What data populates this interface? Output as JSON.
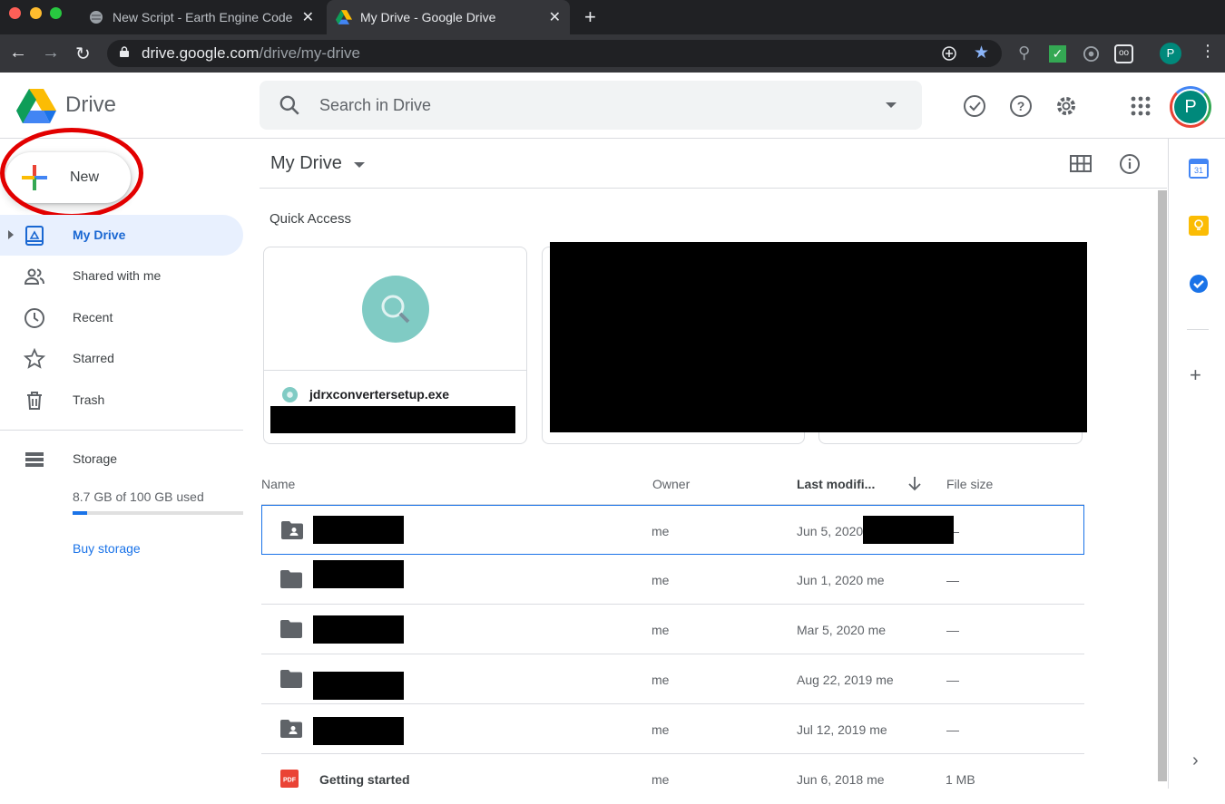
{
  "browser": {
    "tabs": [
      {
        "title": "New Script - Earth Engine Code",
        "icon": "earth-engine-icon",
        "active": false
      },
      {
        "title": "My Drive - Google Drive",
        "icon": "drive-icon",
        "active": true
      }
    ],
    "url_host": "drive.google.com",
    "url_path": "/drive/my-drive",
    "profile_initial": "P"
  },
  "header": {
    "brand": "Drive",
    "search_placeholder": "Search in Drive",
    "avatar_initial": "P"
  },
  "sidebar": {
    "new_label": "New",
    "items": [
      {
        "label": "My Drive",
        "icon": "my-drive-icon",
        "active": true
      },
      {
        "label": "Shared with me",
        "icon": "people-icon",
        "active": false
      },
      {
        "label": "Recent",
        "icon": "clock-icon",
        "active": false
      },
      {
        "label": "Starred",
        "icon": "star-icon",
        "active": false
      },
      {
        "label": "Trash",
        "icon": "trash-icon",
        "active": false
      }
    ],
    "storage": {
      "label": "Storage",
      "used_text": "8.7 GB of 100 GB used",
      "used_fraction": 0.087,
      "buy_label": "Buy storage"
    }
  },
  "main": {
    "title": "My Drive",
    "quick_access_label": "Quick Access",
    "quick_access": [
      {
        "name": "jdrxconvertersetup.exe"
      }
    ],
    "columns": {
      "name": "Name",
      "owner": "Owner",
      "modified": "Last modifi...",
      "size": "File size"
    },
    "rows": [
      {
        "type": "shared-folder",
        "owner": "me",
        "modified": "Jun 5, 2020",
        "modified_by": "",
        "size": "—",
        "selected": true
      },
      {
        "type": "folder",
        "owner": "me",
        "modified": "Jun 1, 2020",
        "modified_by": "me",
        "size": "—",
        "selected": false
      },
      {
        "type": "folder",
        "owner": "me",
        "modified": "Mar 5, 2020",
        "modified_by": "me",
        "size": "—",
        "selected": false
      },
      {
        "type": "folder",
        "owner": "me",
        "modified": "Aug 22, 2019",
        "modified_by": "me",
        "size": "—",
        "selected": false
      },
      {
        "type": "shared-folder",
        "owner": "me",
        "modified": "Jul 12, 2019",
        "modified_by": "me",
        "size": "—",
        "selected": false
      },
      {
        "type": "pdf",
        "name": "Getting started",
        "owner": "me",
        "modified": "Jun 6, 2018",
        "modified_by": "me",
        "size": "1 MB",
        "selected": false
      }
    ]
  },
  "right_panel": {
    "calendar_day": "31"
  },
  "colors": {
    "accent": "#1a73e8",
    "active_nav_bg": "#e8f0fe",
    "annotation": "#e20000"
  }
}
